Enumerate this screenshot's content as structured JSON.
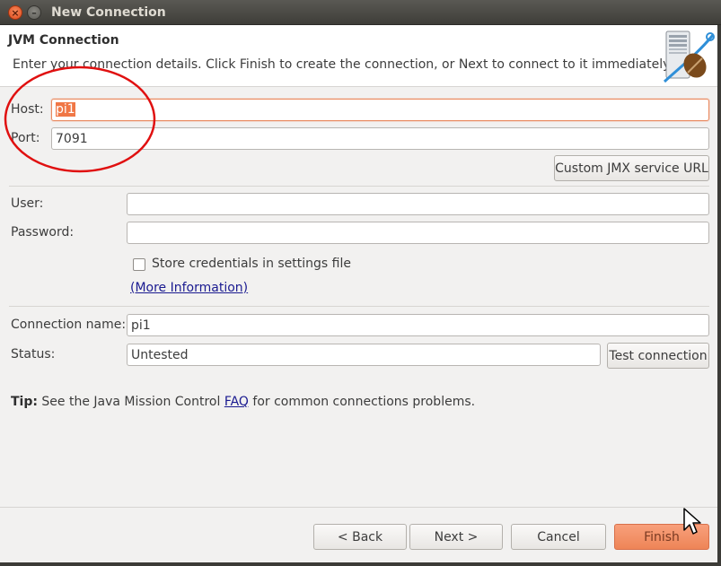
{
  "window": {
    "title": "New Connection"
  },
  "header": {
    "title": "JVM Connection",
    "description": "Enter your connection details. Click Finish to create the connection, or Next to connect to it immediately."
  },
  "form": {
    "host_label": "Host:",
    "host_value": "pi1",
    "port_label": "Port:",
    "port_value": "7091",
    "custom_jmx_label": "Custom JMX service URL",
    "user_label": "User:",
    "user_value": "",
    "password_label": "Password:",
    "password_value": "",
    "store_credentials_label": "Store credentials in settings file",
    "store_credentials_checked": false,
    "more_info_link": "(More Information)",
    "connection_name_label": "Connection name:",
    "connection_name_value": "pi1",
    "status_label": "Status:",
    "status_value": "Untested",
    "test_connection_label": "Test connection"
  },
  "tip": {
    "prefix": "Tip:",
    "text_before": " See the Java Mission Control ",
    "link": "FAQ",
    "text_after": " for common connections problems."
  },
  "footer": {
    "back_label": "< Back",
    "next_label": "Next >",
    "cancel_label": "Cancel",
    "finish_label": "Finish"
  },
  "icons": {
    "close": "close-icon",
    "minimize": "minimize-icon",
    "header_graphic": "jvm-server-icon",
    "cursor": "mouse-pointer-icon"
  },
  "colors": {
    "accent": "#f07746",
    "annotation": "#e01010",
    "link": "#1a1a90"
  }
}
